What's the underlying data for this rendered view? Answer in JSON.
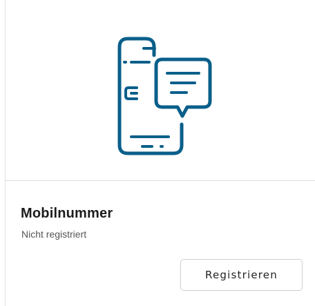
{
  "card": {
    "icon": "mobile-phone-message-icon",
    "title": "Mobilnummer",
    "status": "Nicht registriert",
    "register_label": "Registrieren"
  },
  "colors": {
    "icon": "#0a5f8a",
    "title": "#1c1c1c",
    "subtitle": "#555555",
    "button_border": "#cfcfcf"
  }
}
